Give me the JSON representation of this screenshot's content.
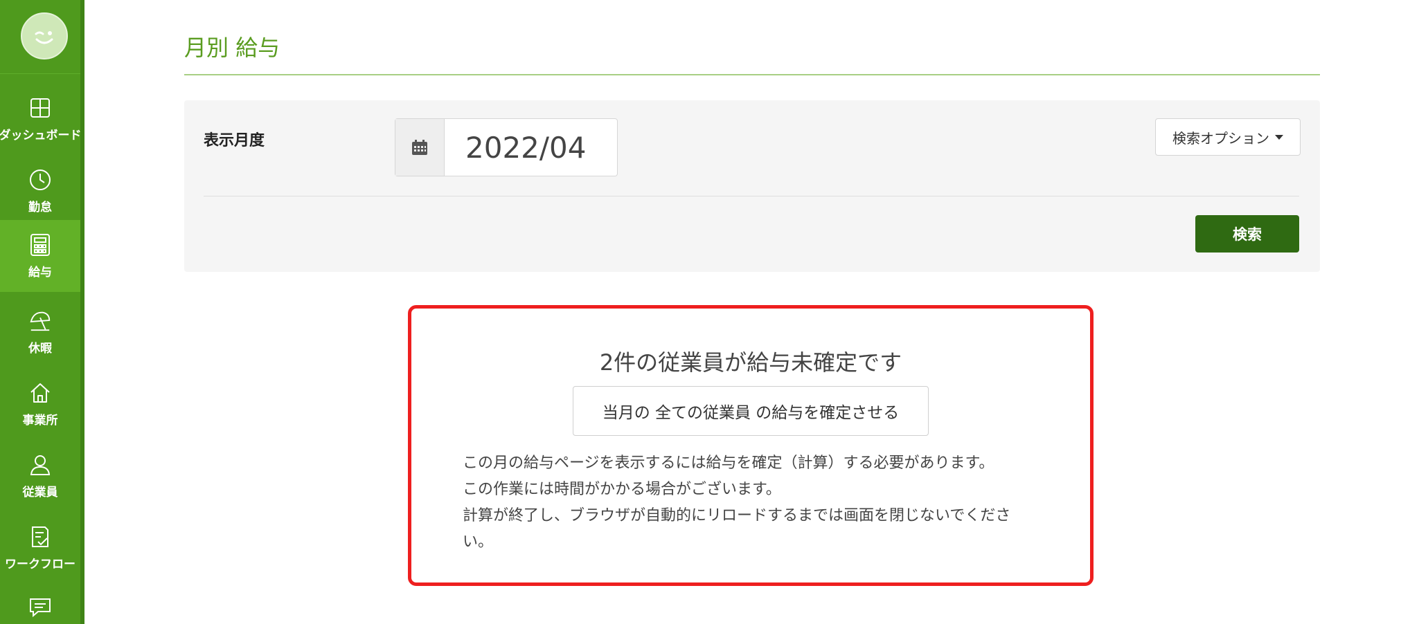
{
  "sidebar": {
    "items": [
      {
        "label": "ダッシュボード",
        "icon": "dashboard-icon"
      },
      {
        "label": "勤怠",
        "icon": "clock-icon"
      },
      {
        "label": "給与",
        "icon": "calculator-icon",
        "active": true
      },
      {
        "label": "休暇",
        "icon": "beach-umbrella-icon"
      },
      {
        "label": "事業所",
        "icon": "home-icon"
      },
      {
        "label": "従業員",
        "icon": "user-icon"
      },
      {
        "label": "ワークフロー",
        "icon": "checklist-icon"
      },
      {
        "label": "",
        "icon": "chat-icon"
      }
    ]
  },
  "main": {
    "title": "月別 給与",
    "search": {
      "month_label": "表示月度",
      "month_value": "2022/04",
      "options_label": "検索オプション",
      "search_label": "検索"
    },
    "notice": {
      "heading": "2件の従業員が給与未確定です",
      "confirm_label": "当月の 全ての従業員 の給与を確定させる",
      "lines": [
        "この月の給与ページを表示するには給与を確定（計算）する必要があります。",
        "この作業には時間がかかる場合がございます。",
        "計算が終了し、ブラウザが自動的にリロードするまでは画面を閉じないでくださ",
        "い。"
      ]
    }
  },
  "colors": {
    "sidebar": "#4f9a1d",
    "sidebar_active": "#62b127",
    "title": "#5a9c20",
    "search_button": "#2f6a12",
    "notice_border": "#ee1f1f"
  }
}
